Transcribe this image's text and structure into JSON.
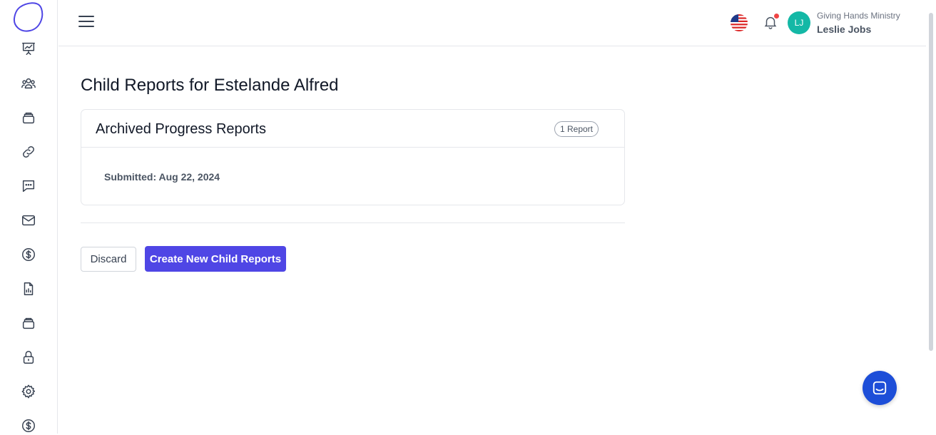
{
  "sidebar": {
    "items": [
      {
        "icon": "presentation-chart-icon"
      },
      {
        "icon": "users-group-icon"
      },
      {
        "icon": "inbox-stack-icon"
      },
      {
        "icon": "link-icon"
      },
      {
        "icon": "chat-bubble-icon"
      },
      {
        "icon": "envelope-icon"
      },
      {
        "icon": "dollar-circle-icon"
      },
      {
        "icon": "document-chart-icon"
      },
      {
        "icon": "inbox-stack-icon"
      },
      {
        "icon": "lock-icon"
      },
      {
        "icon": "gear-icon"
      },
      {
        "icon": "dollar-circle-icon"
      }
    ]
  },
  "header": {
    "org_name": "Giving Hands Ministry",
    "user_name": "Leslie Jobs",
    "avatar_initials": "LJ",
    "flag_icon": "us-flag-icon",
    "notification_dot_color": "#ef4444",
    "avatar_color": "#14b8a6"
  },
  "main": {
    "title": "Child Reports for Estelande Alfred",
    "card": {
      "title": "Archived Progress Reports",
      "badge": "1 Report",
      "submitted_label": "Submitted: Aug 22, 2024"
    },
    "buttons": {
      "discard": "Discard",
      "create": "Create New Child Reports"
    }
  },
  "colors": {
    "accent": "#4f46e5",
    "chat_button": "#1d4ed8"
  }
}
